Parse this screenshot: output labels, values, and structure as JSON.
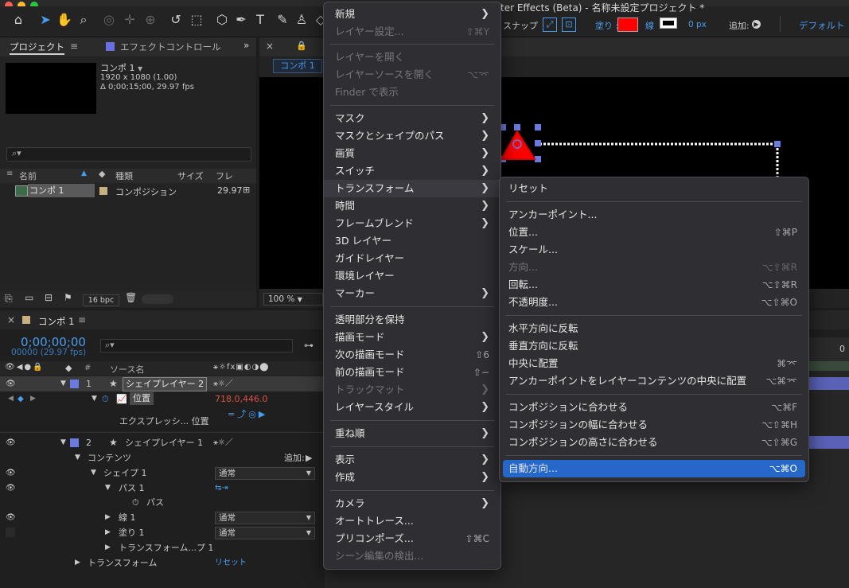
{
  "app_title": "fter Effects (Beta) - 名称未設定プロジェクト *",
  "toolbar": {
    "snap_label": "スナップ",
    "fill_label": "塗り :",
    "stroke_label": "線",
    "stroke_px": "0 px",
    "add_label": "追加:",
    "workspace": "デフォルト",
    "fill_color": "#ff0000"
  },
  "project_panel": {
    "tab_project": "プロジェクト",
    "tab_effects": "エフェクトコントロール",
    "comp_name": "コンポ 1",
    "comp_res": "1920 x 1080 (1.00)",
    "comp_dur": "Δ 0;00;15;00, 29.97 fps",
    "search_placeholder": "",
    "col_name": "名前",
    "col_type": "種類",
    "col_size": "サイズ",
    "col_fr": "フレ",
    "item_name": "コンポ 1",
    "item_type": "コンポジション",
    "item_fr": "29.97",
    "bpc": "16 bpc"
  },
  "viewer": {
    "tab_label": "コンポ 1",
    "zoom": "100 %"
  },
  "timeline": {
    "comp_tab": "コンポ 1",
    "timecode": "0;00;00;00",
    "frames": "00000 (29.97 fps)",
    "col_source": "ソース名",
    "layer1_num": "1",
    "layer1_name": "シェイプレイヤー 2",
    "position_label": "位置",
    "position_value": "718.0,446.0",
    "expression_label": "エクスプレッシ... 位置",
    "layer2_num": "2",
    "layer2_name": "シェイプレイヤー 1",
    "contents_label": "コンテンツ",
    "add_label": "追加:",
    "shape1": "シェイプ 1",
    "blend_normal": "通常",
    "path1": "パス 1",
    "path": "パス",
    "stroke1": "線 1",
    "fill1": "塗り 1",
    "transform_shape": "トランスフォーム...プ 1",
    "transform": "トランスフォーム",
    "reset": "リセット",
    "ruler_num": "0"
  },
  "main_menu": {
    "items": [
      {
        "label": "新規",
        "arrow": true
      },
      {
        "label": "レイヤー設定...",
        "shortcut": "⇧⌘Y",
        "disabled": true
      },
      {
        "label": "レイヤーを開く",
        "disabled": true
      },
      {
        "label": "レイヤーソースを開く",
        "shortcut": "⌥⌤",
        "disabled": true
      },
      {
        "label": "Finder で表示",
        "disabled": true
      },
      {
        "label": "マスク",
        "arrow": true
      },
      {
        "label": "マスクとシェイプのパス",
        "arrow": true
      },
      {
        "label": "画質",
        "arrow": true
      },
      {
        "label": "スイッチ",
        "arrow": true
      },
      {
        "label": "トランスフォーム",
        "arrow": true
      },
      {
        "label": "時間",
        "arrow": true
      },
      {
        "label": "フレームブレンド",
        "arrow": true
      },
      {
        "label": "3D レイヤー"
      },
      {
        "label": "ガイドレイヤー"
      },
      {
        "label": "環境レイヤー"
      },
      {
        "label": "マーカー",
        "arrow": true
      },
      {
        "label": "透明部分を保持"
      },
      {
        "label": "描画モード",
        "arrow": true
      },
      {
        "label": "次の描画モード",
        "shortcut": "⇧6"
      },
      {
        "label": "前の描画モード",
        "shortcut": "⇧−"
      },
      {
        "label": "トラックマット",
        "arrow": true,
        "disabled": true
      },
      {
        "label": "レイヤースタイル",
        "arrow": true
      },
      {
        "label": "重ね順",
        "arrow": true
      },
      {
        "label": "表示",
        "arrow": true
      },
      {
        "label": "作成",
        "arrow": true
      },
      {
        "label": "カメラ",
        "arrow": true
      },
      {
        "label": "オートトレース..."
      },
      {
        "label": "プリコンポーズ...",
        "shortcut": "⇧⌘C"
      },
      {
        "label": "シーン編集の検出...",
        "disabled": true
      }
    ]
  },
  "sub_menu": {
    "items": [
      {
        "label": "リセット"
      },
      {
        "label": "アンカーポイント..."
      },
      {
        "label": "位置...",
        "shortcut": "⇧⌘P"
      },
      {
        "label": "スケール..."
      },
      {
        "label": "方向...",
        "shortcut": "⌥⇧⌘R",
        "disabled": true
      },
      {
        "label": "回転...",
        "shortcut": "⌥⇧⌘R"
      },
      {
        "label": "不透明度...",
        "shortcut": "⌥⇧⌘O"
      },
      {
        "label": "水平方向に反転"
      },
      {
        "label": "垂直方向に反転"
      },
      {
        "label": "中央に配置",
        "shortcut": "⌘⌤"
      },
      {
        "label": "アンカーポイントをレイヤーコンテンツの中央に配置",
        "shortcut": "⌥⌘⌤"
      },
      {
        "label": "コンポジションに合わせる",
        "shortcut": "⌥⌘F"
      },
      {
        "label": "コンポジションの幅に合わせる",
        "shortcut": "⌥⇧⌘H"
      },
      {
        "label": "コンポジションの高さに合わせる",
        "shortcut": "⌥⇧⌘G"
      },
      {
        "label": "自動方向...",
        "shortcut": "⌥⌘O"
      }
    ]
  }
}
